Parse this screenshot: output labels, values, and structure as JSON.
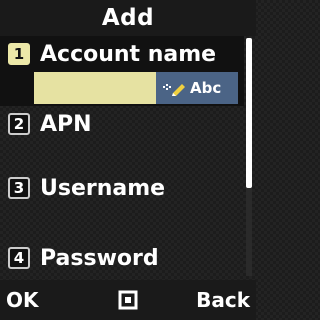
{
  "header": {
    "title": "Add"
  },
  "fields": [
    {
      "number": "1",
      "label": "Account name",
      "selected": true,
      "value": ""
    },
    {
      "number": "2",
      "label": "APN"
    },
    {
      "number": "3",
      "label": "Username"
    },
    {
      "number": "4",
      "label": "Password"
    }
  ],
  "input_mode": {
    "icon": "t9-pen-icon",
    "text": "Abc"
  },
  "softkeys": {
    "left": "OK",
    "center_icon": "menu-square-icon",
    "right": "Back"
  },
  "colors": {
    "selection": "#ece8a8",
    "input_background": "#e6e2a2",
    "mode_indicator": "#4b6486",
    "background": "#1c1c1c"
  }
}
